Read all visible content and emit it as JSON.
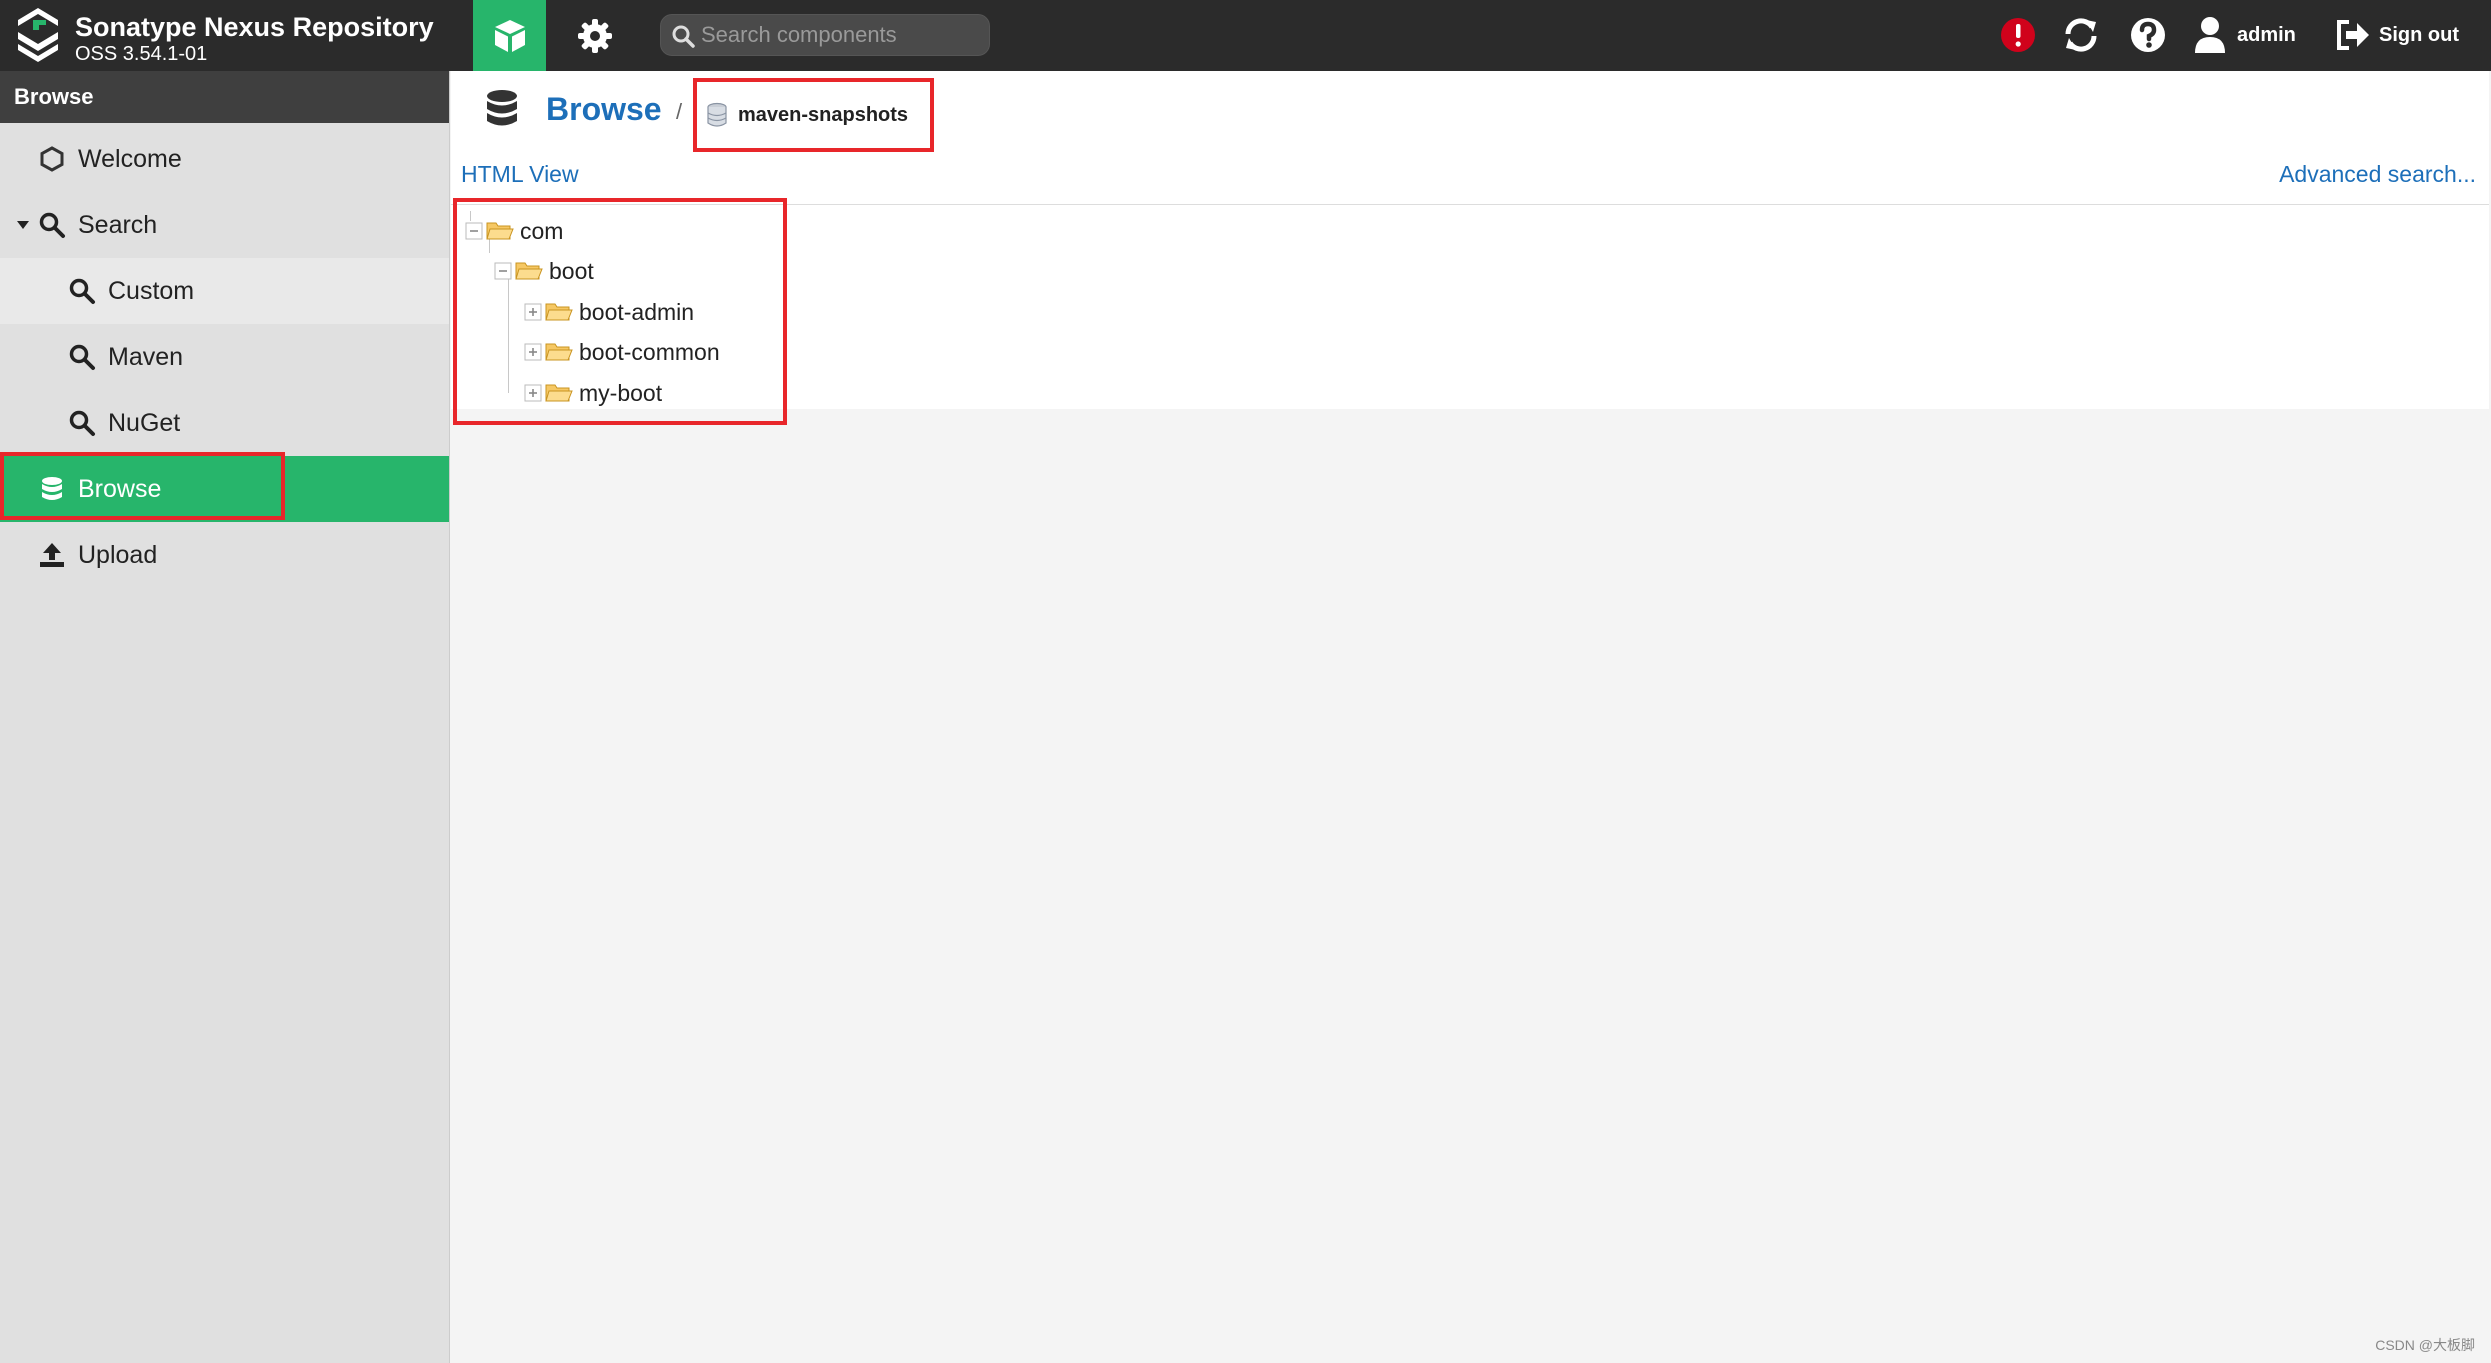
{
  "app": {
    "title": "Sonatype Nexus Repository",
    "version": "OSS 3.54.1-01"
  },
  "header": {
    "search_placeholder": "Search components",
    "user_label": "admin",
    "signout_label": "Sign out",
    "icons": [
      "nexus-logo-icon",
      "cube-icon",
      "gear-icon",
      "search-icon",
      "alert-icon",
      "refresh-icon",
      "help-icon",
      "user-icon",
      "sign-out-icon"
    ]
  },
  "colors": {
    "header_bg": "#2b2b2b",
    "accent_green": "#27b56b",
    "link_blue": "#1d6fb9",
    "alert_red": "#d0021b",
    "highlight_red": "#e8262a",
    "sidebar_bg": "#e0e0e0"
  },
  "sidebar": {
    "header": "Browse",
    "items": [
      {
        "label": "Welcome",
        "icon": "hexagon-icon"
      },
      {
        "label": "Search",
        "icon": "search-icon",
        "expanded": true
      },
      {
        "label": "Custom",
        "icon": "search-icon"
      },
      {
        "label": "Maven",
        "icon": "search-icon"
      },
      {
        "label": "NuGet",
        "icon": "search-icon"
      },
      {
        "label": "Browse",
        "icon": "database-icon",
        "selected": true
      },
      {
        "label": "Upload",
        "icon": "upload-icon"
      }
    ]
  },
  "main": {
    "breadcrumb": {
      "root": "Browse",
      "separator": "/",
      "current": "maven-snapshots"
    },
    "html_view_label": "HTML View",
    "advanced_search_label": "Advanced search...",
    "tree": [
      {
        "label": "com",
        "expanded": true
      },
      {
        "label": "boot",
        "expanded": true
      },
      {
        "label": "boot-admin",
        "expanded": false
      },
      {
        "label": "boot-common",
        "expanded": false
      },
      {
        "label": "my-boot",
        "expanded": false
      }
    ]
  },
  "watermark": "CSDN @大板脚"
}
